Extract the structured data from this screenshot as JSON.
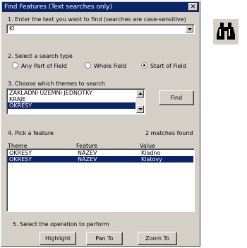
{
  "window": {
    "title": "Find Features (Text searches only)",
    "close_label": "✕"
  },
  "step1": {
    "label": "1. Enter the text you want to find (searches are case-sensitive)",
    "value": "Kl"
  },
  "step2": {
    "label": "2. Select a search type",
    "options": [
      {
        "label": "Any Part of Field",
        "checked": false
      },
      {
        "label": "Whole Field",
        "checked": false
      },
      {
        "label": "Start of Field",
        "checked": true
      }
    ]
  },
  "step3": {
    "label": "3. Choose which themes to search",
    "themes": [
      "ZÁKLADNÍ ÚZEMNÍ JEDNOTKY",
      "KRAJE",
      "OKRESY"
    ],
    "selected_index": 2,
    "find_label": "Find"
  },
  "step4": {
    "label": "4. Pick a feature",
    "matches": "2 matches found",
    "columns": [
      "Theme",
      "Feature",
      "Value"
    ],
    "rows": [
      {
        "theme": "OKRESY",
        "feature": "NÁZEV",
        "value": "Kladno",
        "selected": false
      },
      {
        "theme": "OKRESY",
        "feature": "NÁZEV",
        "value": "Klatovy",
        "selected": true
      }
    ]
  },
  "step5": {
    "label": "5. Select the operation to perform",
    "buttons": [
      "Highlight",
      "Pan To",
      "Zoom To"
    ]
  },
  "toolbar": {
    "find_tool_icon": "binoculars-icon"
  },
  "colors": {
    "selection": "#0a246a",
    "dialog": "#d4d0c8"
  }
}
